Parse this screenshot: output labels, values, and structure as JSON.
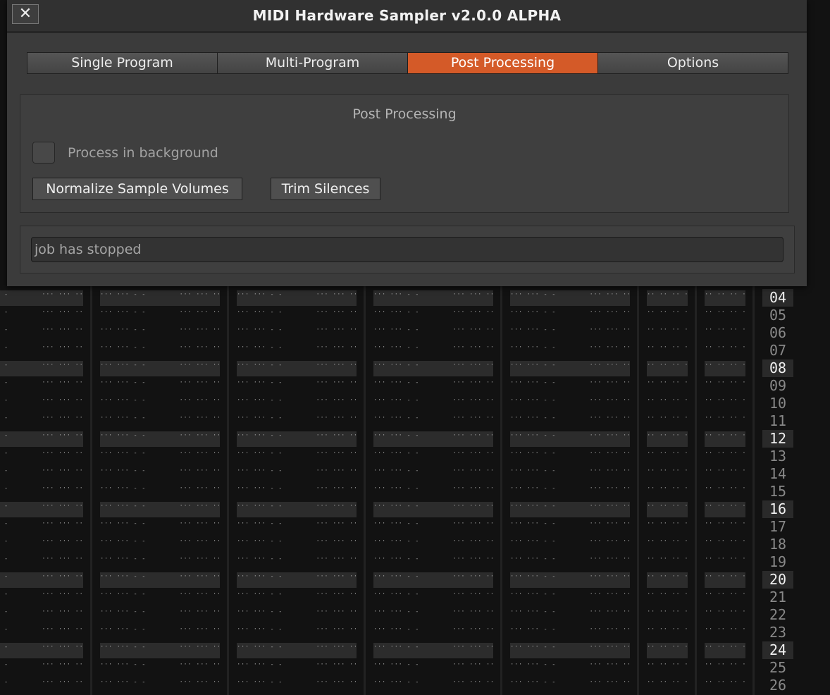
{
  "window": {
    "title": "MIDI Hardware Sampler v2.0.0 ALPHA",
    "close_label": "✕"
  },
  "tabs": [
    {
      "label": "Single Program",
      "active": false
    },
    {
      "label": "Multi-Program",
      "active": false
    },
    {
      "label": "Post Processing",
      "active": true
    },
    {
      "label": "Options",
      "active": false
    }
  ],
  "post_processing": {
    "group_title": "Post Processing",
    "background_checkbox": {
      "label": "Process in background",
      "checked": false
    },
    "normalize_label": "Normalize Sample Volumes",
    "trim_label": "Trim Silences"
  },
  "status": {
    "value": "job has stopped"
  },
  "tracker": {
    "row_numbers": [
      "04",
      "05",
      "06",
      "07",
      "08",
      "09",
      "10",
      "11",
      "12",
      "13",
      "14",
      "15",
      "16",
      "17",
      "18",
      "19",
      "20",
      "21",
      "22",
      "23",
      "24",
      "25",
      "26"
    ],
    "beat_rows": [
      "04",
      "08",
      "12",
      "16",
      "20",
      "24"
    ],
    "colors": {
      "background": "#121212",
      "beat_row": "#2c2c2c",
      "dots": "#9a9a9a",
      "volume": "#c8b400"
    }
  },
  "colors": {
    "accent": "#d45a28",
    "dialog_bg": "#3b3b3b"
  }
}
